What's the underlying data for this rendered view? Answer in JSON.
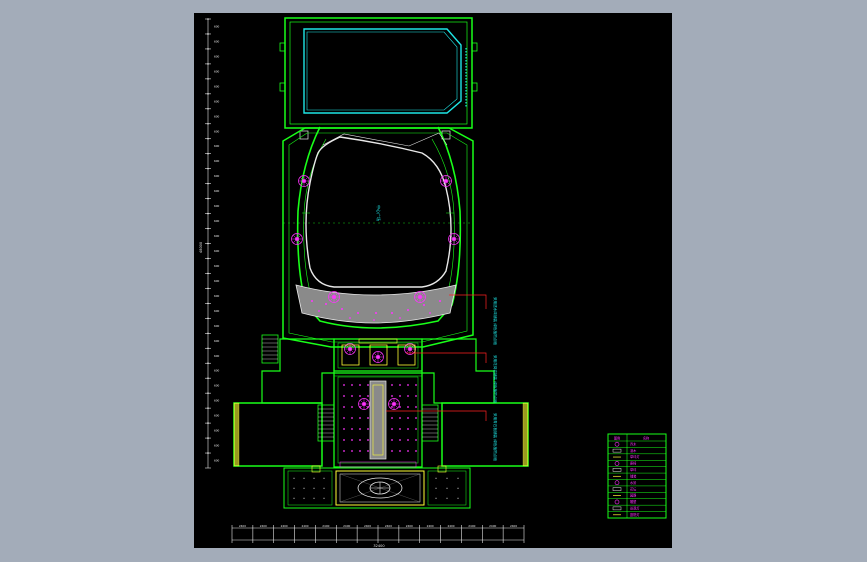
{
  "viewer": {
    "background": "#a3acb9",
    "sheet_background": "#000000"
  },
  "colors": {
    "wall": "#19ff19",
    "cyan": "#1ee6e6",
    "yellow": "#ffff33",
    "magenta": "#ff33ff",
    "red": "#ff2222",
    "grey": "#8a8a8a",
    "white": "#e8e8e8"
  },
  "annotations": {
    "arena_label": "中心广场",
    "note_1": "采用透水砖铺装 绿色植物点缀",
    "note_2": "采用花岗岩铺装 绿色植物点缀",
    "note_3": "采用青石板铺装 绿色植物点缀"
  },
  "dimensions": {
    "vertical": [
      "600",
      "600",
      "600",
      "600",
      "600",
      "600",
      "600",
      "600",
      "600",
      "600",
      "600",
      "600",
      "600",
      "600",
      "600",
      "600",
      "600",
      "600",
      "600",
      "600",
      "600",
      "600",
      "600",
      "600",
      "600",
      "600",
      "600",
      "600",
      "600",
      "600"
    ],
    "horizontal": [
      "2400",
      "2400",
      "2400",
      "2400",
      "2400",
      "2400",
      "2400",
      "2400",
      "2400",
      "2400",
      "2400",
      "2400",
      "2400",
      "2400"
    ],
    "total_h": "32400",
    "total_v": "48000"
  },
  "legend": {
    "headers": [
      "图例",
      "名称"
    ],
    "rows": [
      {
        "icon": "tree-icon",
        "label": "乔木"
      },
      {
        "icon": "shrub-icon",
        "label": "灌木"
      },
      {
        "icon": "lamp-icon",
        "label": "草坪灯"
      },
      {
        "icon": "bench-icon",
        "label": "座椅"
      },
      {
        "icon": "grass-icon",
        "label": "草坪"
      },
      {
        "icon": "paving-icon",
        "label": "铺装"
      },
      {
        "icon": "water-icon",
        "label": "水景"
      },
      {
        "icon": "flower-icon",
        "label": "花坛"
      },
      {
        "icon": "path-icon",
        "label": "园路"
      },
      {
        "icon": "sculpture-icon",
        "label": "雕塑"
      },
      {
        "icon": "light-icon",
        "label": "景观灯"
      },
      {
        "icon": "cross-icon",
        "label": "庭院灯"
      }
    ]
  }
}
